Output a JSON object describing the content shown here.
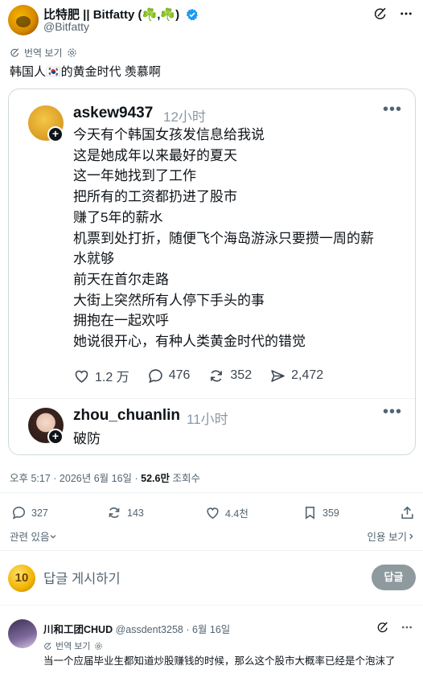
{
  "author": {
    "name": "比特肥 || Bitfatty (☘️,☘️)",
    "handle": "@Bitfatty"
  },
  "translate_label": "번역 보기",
  "tweet_text": "韩国人🇰🇷的黄金时代 羡慕啊",
  "quoted": {
    "user1": {
      "name": "askew9437",
      "time": "12小时"
    },
    "lines": [
      "今天有个韩国女孩发信息给我说",
      "这是她成年以来最好的夏天",
      "这一年她找到了工作",
      "把所有的工资都扔进了股市",
      "赚了5年的薪水",
      "机票到处打折，随便飞个海岛游泳只要攒一周的薪",
      "水就够",
      "前天在首尔走路",
      "大街上突然所有人停下手头的事",
      "拥抱在一起欢呼",
      "她说很开心，有种人类黄金时代的错觉"
    ],
    "actions": {
      "likes": "1.2 万",
      "replies": "476",
      "reposts": "352",
      "shares": "2,472"
    },
    "user2": {
      "name": "zhou_chuanlin",
      "time": "11小时",
      "text": "破防"
    }
  },
  "meta": {
    "time": "오후 5:17 · 2026년 6월 16일 · ",
    "views": "52.6만",
    "views_label": " 조회수"
  },
  "stats": {
    "replies": "327",
    "reposts": "143",
    "likes": "4.4천",
    "bookmarks": "359"
  },
  "related_label": "관련 있음",
  "quotes_label": "인용 보기",
  "reply_box": {
    "coin": "10",
    "placeholder": "답글 게시하기",
    "button": "답글"
  },
  "reply_tweet": {
    "name": "川和工团CHUD",
    "handle_time": " @assdent3258 · 6월 16일",
    "translate_label": "번역 보기",
    "text": "当一个应届毕业生都知道炒股赚钱的时候，那么这个股市大概率已经是个泡沫了"
  },
  "colors": {
    "text": "#0f1419",
    "muted": "#536471",
    "verified": "#1d9bf0",
    "border": "#cfd9de"
  }
}
